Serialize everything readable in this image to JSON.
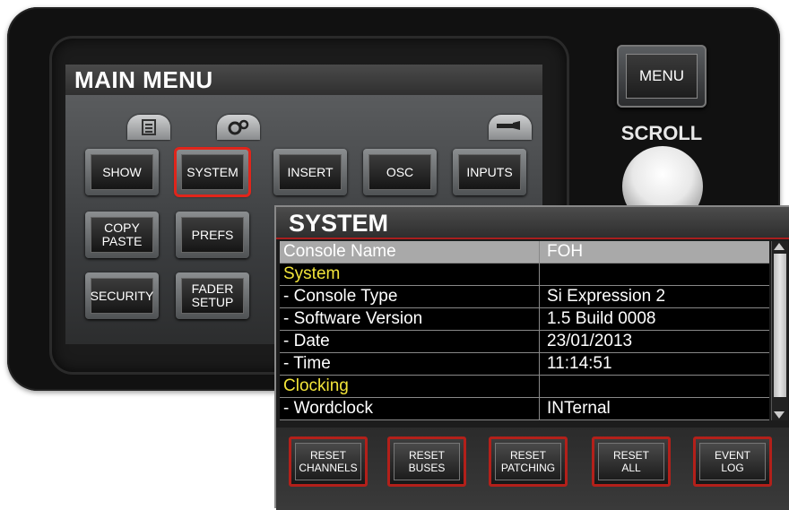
{
  "main_menu": {
    "title": "MAIN MENU",
    "tab_icons": [
      "list-icon",
      "gears-icon",
      "connector-icon"
    ],
    "buttons": [
      {
        "label": "SHOW",
        "selected": false
      },
      {
        "label": "SYSTEM",
        "selected": true
      },
      {
        "label": "INSERT",
        "selected": false
      },
      {
        "label": "OSC",
        "selected": false
      },
      {
        "label": "INPUTS",
        "selected": false
      },
      {
        "label": "COPY\nPASTE",
        "selected": false
      },
      {
        "label": "PREFS",
        "selected": false
      },
      {
        "label": "SECURITY",
        "selected": false
      },
      {
        "label": "FADER\nSETUP",
        "selected": false
      }
    ]
  },
  "hardware": {
    "menu_label": "MENU",
    "scroll_label": "SCROLL"
  },
  "system_panel": {
    "title": "SYSTEM",
    "rows": [
      {
        "key": "Console Name",
        "value": "FOH",
        "type": "highlight"
      },
      {
        "key": "System",
        "value": "",
        "type": "section"
      },
      {
        "key": "- Console Type",
        "value": "Si Expression 2",
        "type": "item"
      },
      {
        "key": "- Software Version",
        "value": "1.5 Build 0008",
        "type": "item"
      },
      {
        "key": "- Date",
        "value": "23/01/2013",
        "type": "item"
      },
      {
        "key": "- Time",
        "value": "11:14:51",
        "type": "item"
      },
      {
        "key": "Clocking",
        "value": "",
        "type": "section"
      },
      {
        "key": "- Wordclock",
        "value": "INTernal",
        "type": "item"
      }
    ],
    "actions": [
      "RESET\nCHANNELS",
      "RESET\nBUSES",
      "RESET\nPATCHING",
      "RESET\nALL",
      "EVENT\nLOG"
    ]
  },
  "colors": {
    "accent_red": "#e0251b",
    "section_yellow": "#f2e43a",
    "highlight_row": "#a9a9a9"
  }
}
